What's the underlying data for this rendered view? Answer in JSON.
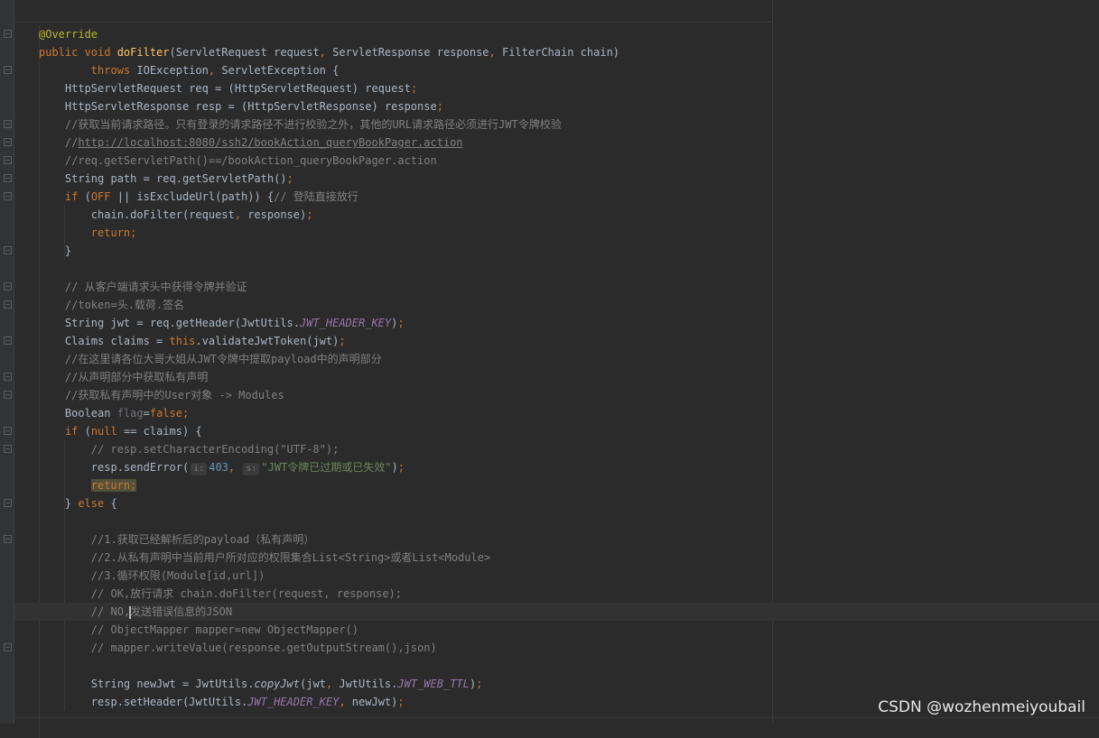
{
  "editor": {
    "lines": [
      {
        "id": "override",
        "tokens": [
          {
            "t": "@Override",
            "c": "ann"
          }
        ]
      },
      {
        "id": "dofilter-sig",
        "tokens": [
          {
            "t": "public void ",
            "c": "kw"
          },
          {
            "t": "doFilter",
            "c": "fn"
          },
          {
            "t": "(ServletRequest request",
            "c": ""
          },
          {
            "t": ", ",
            "c": "kw"
          },
          {
            "t": "ServletResponse response",
            "c": ""
          },
          {
            "t": ", ",
            "c": "kw"
          },
          {
            "t": "FilterChain chain)",
            "c": ""
          }
        ]
      },
      {
        "id": "throws",
        "tokens": [
          {
            "t": "        throws ",
            "c": "kw"
          },
          {
            "t": "IOException",
            "c": ""
          },
          {
            "t": ", ",
            "c": "kw"
          },
          {
            "t": "ServletException {",
            "c": ""
          }
        ]
      },
      {
        "id": "req",
        "tokens": [
          {
            "t": "    HttpServletRequest req = (HttpServletRequest) request",
            "c": ""
          },
          {
            "t": ";",
            "c": "kw"
          }
        ]
      },
      {
        "id": "resp",
        "tokens": [
          {
            "t": "    HttpServletResponse resp = (HttpServletResponse) response",
            "c": ""
          },
          {
            "t": ";",
            "c": "kw"
          }
        ]
      },
      {
        "id": "c1",
        "tokens": [
          {
            "t": "    //获取当前请求路径。只有登录的请求路径不进行校验之外，其他的URL请求路径必须进行JWT令牌校验",
            "c": "cm"
          }
        ]
      },
      {
        "id": "c2",
        "tokens": [
          {
            "t": "    //",
            "c": "cm"
          },
          {
            "t": "http://localhost:8080/ssh2/bookAction_queryBookPager.action",
            "c": "link"
          }
        ]
      },
      {
        "id": "c3",
        "tokens": [
          {
            "t": "    //req.getServletPath()==/bookAction_queryBookPager.action",
            "c": "cm"
          }
        ]
      },
      {
        "id": "path",
        "tokens": [
          {
            "t": "    String path = req.getServletPath()",
            "c": ""
          },
          {
            "t": ";",
            "c": "kw"
          }
        ]
      },
      {
        "id": "if-off",
        "tokens": [
          {
            "t": "    if ",
            "c": "kw"
          },
          {
            "t": "(",
            "c": ""
          },
          {
            "t": "OFF",
            "c": "kw"
          },
          {
            "t": " || isExcludeUrl(path)) {",
            "c": ""
          },
          {
            "t": "// 登陆直接放行",
            "c": "cm"
          }
        ]
      },
      {
        "id": "chain-do",
        "tokens": [
          {
            "t": "        chain.doFilter(request",
            "c": ""
          },
          {
            "t": ", ",
            "c": "kw"
          },
          {
            "t": "response)",
            "c": ""
          },
          {
            "t": ";",
            "c": "kw"
          }
        ]
      },
      {
        "id": "return1",
        "tokens": [
          {
            "t": "        return;",
            "c": "kw"
          }
        ]
      },
      {
        "id": "close1",
        "tokens": [
          {
            "t": "    }",
            "c": ""
          }
        ]
      },
      {
        "id": "blank1",
        "tokens": []
      },
      {
        "id": "c4",
        "tokens": [
          {
            "t": "    // 从客户端请求头中获得令牌并验证",
            "c": "cm"
          }
        ]
      },
      {
        "id": "c5",
        "tokens": [
          {
            "t": "    //token=头.载荷.签名",
            "c": "cm"
          }
        ]
      },
      {
        "id": "jwt",
        "tokens": [
          {
            "t": "    String jwt = req.getHeader(JwtUtils.",
            "c": ""
          },
          {
            "t": "JWT_HEADER_KEY",
            "c": "const"
          },
          {
            "t": ")",
            "c": ""
          },
          {
            "t": ";",
            "c": "kw"
          }
        ]
      },
      {
        "id": "claims",
        "tokens": [
          {
            "t": "    Claims claims = ",
            "c": ""
          },
          {
            "t": "this",
            "c": "kw"
          },
          {
            "t": ".validateJwtToken(jwt)",
            "c": ""
          },
          {
            "t": ";",
            "c": "kw"
          }
        ]
      },
      {
        "id": "c6",
        "tokens": [
          {
            "t": "    //在这里请各位大哥大姐从JWT令牌中提取payload中的声明部分",
            "c": "cm"
          }
        ]
      },
      {
        "id": "c7",
        "tokens": [
          {
            "t": "    //从声明部分中获取私有声明",
            "c": "cm"
          }
        ]
      },
      {
        "id": "c8",
        "tokens": [
          {
            "t": "    //获取私有声明中的User对象 -> Modules",
            "c": "cm"
          }
        ]
      },
      {
        "id": "flag",
        "tokens": [
          {
            "t": "    Boolean ",
            "c": ""
          },
          {
            "t": "flag",
            "c": "muted"
          },
          {
            "t": "=",
            "c": ""
          },
          {
            "t": "false",
            "c": "kw"
          },
          {
            "t": ";",
            "c": "kw"
          }
        ]
      },
      {
        "id": "if-null",
        "tokens": [
          {
            "t": "    if ",
            "c": "kw"
          },
          {
            "t": "(",
            "c": ""
          },
          {
            "t": "null",
            "c": "kw"
          },
          {
            "t": " == claims) {",
            "c": ""
          }
        ]
      },
      {
        "id": "c9",
        "tokens": [
          {
            "t": "        // resp.setCharacterEncoding(\"UTF-8\");",
            "c": "cm"
          }
        ]
      },
      {
        "id": "senderror",
        "tokens": [
          {
            "t": "        resp.sendError(",
            "c": ""
          },
          {
            "t": "i:",
            "c": "hint"
          },
          {
            "t": "403",
            "c": "num"
          },
          {
            "t": ", ",
            "c": "kw"
          },
          {
            "t": "s:",
            "c": "hint"
          },
          {
            "t": "\"JWT令牌已过期或已失效\"",
            "c": "str"
          },
          {
            "t": ")",
            "c": ""
          },
          {
            "t": ";",
            "c": "kw"
          }
        ]
      },
      {
        "id": "return2",
        "tokens": [
          {
            "t": "        ",
            "c": ""
          },
          {
            "t": "return;",
            "c": "kw hl"
          }
        ]
      },
      {
        "id": "else",
        "tokens": [
          {
            "t": "    } ",
            "c": ""
          },
          {
            "t": "else ",
            "c": "kw"
          },
          {
            "t": "{",
            "c": ""
          }
        ]
      },
      {
        "id": "blank2",
        "tokens": []
      },
      {
        "id": "c10",
        "tokens": [
          {
            "t": "        //1.获取已经解析后的payload（私有声明）",
            "c": "cm"
          }
        ]
      },
      {
        "id": "c11",
        "tokens": [
          {
            "t": "        //2.从私有声明中当前用户所对应的权限集合List<String>或者List<Module>",
            "c": "cm"
          }
        ]
      },
      {
        "id": "c12",
        "tokens": [
          {
            "t": "        //3.循环权限(Module[id,url])",
            "c": "cm"
          }
        ]
      },
      {
        "id": "c13",
        "tokens": [
          {
            "t": "        // OK,放行请求 chain.doFilter(request, response);",
            "c": "cm"
          }
        ]
      },
      {
        "id": "c14",
        "tokens": [
          {
            "t": "        // NO,",
            "c": "cm"
          },
          {
            "t": "",
            "c": "caret"
          },
          {
            "t": "发送错误信息的JSON",
            "c": "cm"
          }
        ]
      },
      {
        "id": "c15",
        "tokens": [
          {
            "t": "        // ObjectMapper mapper=new ObjectMapper()",
            "c": "cm"
          }
        ]
      },
      {
        "id": "c16",
        "tokens": [
          {
            "t": "        // mapper.writeValue(response.getOutputStream(),json)",
            "c": "cm"
          }
        ]
      },
      {
        "id": "blank3",
        "tokens": []
      },
      {
        "id": "newjwt",
        "tokens": [
          {
            "t": "        String newJwt = JwtUtils.",
            "c": ""
          },
          {
            "t": "copyJwt",
            "c": "italic-fn"
          },
          {
            "t": "(jwt",
            "c": ""
          },
          {
            "t": ", ",
            "c": "kw"
          },
          {
            "t": "JwtUtils.",
            "c": ""
          },
          {
            "t": "JWT_WEB_TTL",
            "c": "const"
          },
          {
            "t": ")",
            "c": ""
          },
          {
            "t": ";",
            "c": "kw"
          }
        ]
      },
      {
        "id": "setheader",
        "tokens": [
          {
            "t": "        resp.setHeader(JwtUtils.",
            "c": ""
          },
          {
            "t": "JWT_HEADER_KEY",
            "c": "const"
          },
          {
            "t": ", ",
            "c": "kw"
          },
          {
            "t": "newJwt)",
            "c": ""
          },
          {
            "t": ";",
            "c": "kw"
          }
        ]
      }
    ]
  },
  "watermark": "CSDN @wozhenmeiyoubail"
}
